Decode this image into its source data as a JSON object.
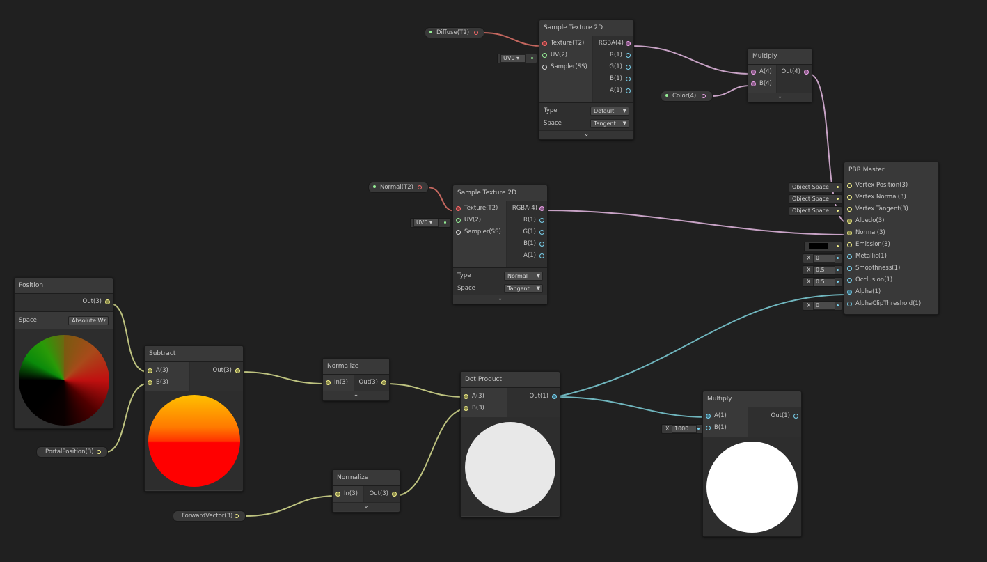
{
  "colors": {
    "background": "#202020",
    "node_body": "#393939",
    "wire_texture": "#c5675f",
    "wire_vector4": "#c7a2c5",
    "wire_vector3": "#bdc27f",
    "wire_vector1": "#6fb5bd",
    "port_texture": "#ff6a6a",
    "port_vector4": "#f2a6ef",
    "port_vector3": "#f5f28a",
    "port_vector2": "#96ef96",
    "port_vector1": "#7ad3f0",
    "port_sampler": "#d8d8d8"
  },
  "properties": {
    "diffuse": "Diffuse(T2)",
    "normal": "Normal(T2)",
    "color": "Color(4)",
    "portal_position": "PortalPosition(3)",
    "forward_vector": "ForwardVector(3)"
  },
  "sample_texture_top": {
    "title": "Sample Texture 2D",
    "inputs": [
      "Texture(T2)",
      "UV(2)",
      "Sampler(SS)"
    ],
    "outputs": [
      "RGBA(4)",
      "R(1)",
      "G(1)",
      "B(1)",
      "A(1)"
    ],
    "type_label": "Type",
    "type_value": "Default",
    "space_label": "Space",
    "space_value": "Tangent",
    "uv": "UV0"
  },
  "sample_texture_mid": {
    "title": "Sample Texture 2D",
    "inputs": [
      "Texture(T2)",
      "UV(2)",
      "Sampler(SS)"
    ],
    "outputs": [
      "RGBA(4)",
      "R(1)",
      "G(1)",
      "B(1)",
      "A(1)"
    ],
    "type_label": "Type",
    "type_value": "Normal",
    "space_label": "Space",
    "space_value": "Tangent",
    "uv": "UV0"
  },
  "multiply_top": {
    "title": "Multiply",
    "inputs": [
      "A(4)",
      "B(4)"
    ],
    "output": "Out(4)"
  },
  "pbr_master": {
    "title": "PBR Master",
    "inputs": [
      "Vertex Position(3)",
      "Vertex Normal(3)",
      "Vertex Tangent(3)",
      "Albedo(3)",
      "Normal(3)",
      "Emission(3)",
      "Metallic(1)",
      "Smoothness(1)",
      "Occlusion(1)",
      "Alpha(1)",
      "AlphaClipThreshold(1)"
    ],
    "space_fields": [
      "Object Space",
      "Object Space",
      "Object Space"
    ],
    "x_label": "X",
    "metallic": "0",
    "smoothness": "0.5",
    "occlusion": "0.5",
    "alpha_clip": "0"
  },
  "position": {
    "title": "Position",
    "output": "Out(3)",
    "space_label": "Space",
    "space_value": "Absolute W"
  },
  "subtract": {
    "title": "Subtract",
    "inputs": [
      "A(3)",
      "B(3)"
    ],
    "output": "Out(3)"
  },
  "normalize_top": {
    "title": "Normalize",
    "input": "In(3)",
    "output": "Out(3)"
  },
  "normalize_bottom": {
    "title": "Normalize",
    "input": "In(3)",
    "output": "Out(3)"
  },
  "dot_product": {
    "title": "Dot Product",
    "inputs": [
      "A(3)",
      "B(3)"
    ],
    "output": "Out(1)"
  },
  "multiply_bottom": {
    "title": "Multiply",
    "inputs": [
      "A(1)",
      "B(1)"
    ],
    "output": "Out(1)",
    "x_label": "X",
    "b_value": "1000"
  }
}
